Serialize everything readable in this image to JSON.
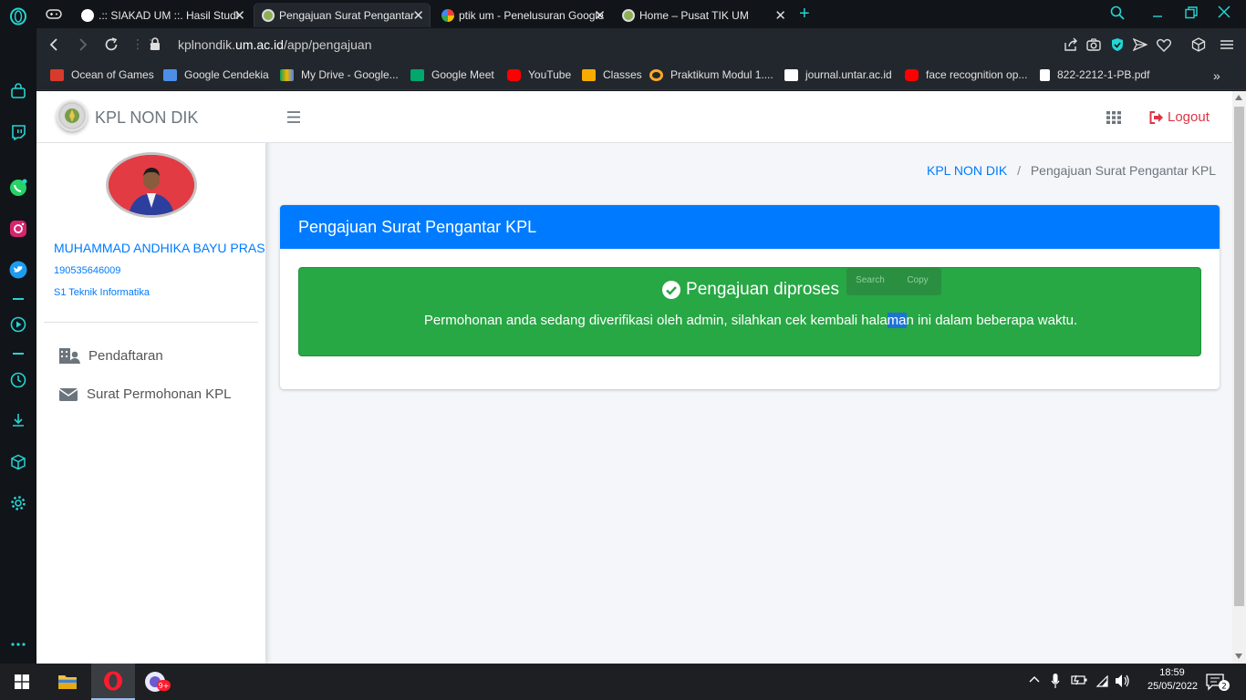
{
  "browser": {
    "tabs": [
      {
        "title": ".:: SIAKAD UM ::. Hasil Studi",
        "active": false
      },
      {
        "title": "Pengajuan Surat Pengantar",
        "active": true
      },
      {
        "title": "ptik um - Penelusuran Google",
        "active": false
      },
      {
        "title": "Home – Pusat TIK UM",
        "active": false
      }
    ],
    "url_prefix": "kplnondik.",
    "url_domain": "um.ac.id",
    "url_path": "/app/pengajuan",
    "bookmarks": [
      {
        "label": "Ocean of Games",
        "icon": "gamepad-icon",
        "color": "#d83a2c"
      },
      {
        "label": "Google Cendekia",
        "icon": "graduation-cap-icon",
        "color": "#4d8fe8"
      },
      {
        "label": "My Drive - Google...",
        "icon": "google-drive-icon",
        "color": "#f4b400"
      },
      {
        "label": "Google Meet",
        "icon": "google-meet-icon",
        "color": "#00a86b"
      },
      {
        "label": "YouTube",
        "icon": "youtube-icon",
        "color": "#ff0000"
      },
      {
        "label": "Classes",
        "icon": "classroom-icon",
        "color": "#f9ab00"
      },
      {
        "label": "Praktikum Modul 1....",
        "icon": "colab-icon",
        "color": "#f9a825"
      },
      {
        "label": "journal.untar.ac.id",
        "icon": "pkp-icon",
        "color": "#ffffff"
      },
      {
        "label": "face recognition op...",
        "icon": "youtube-icon",
        "color": "#ff0000"
      },
      {
        "label": "822-2212-1-PB.pdf",
        "icon": "file-icon",
        "color": "#ffffff"
      }
    ]
  },
  "app": {
    "brand": "KPL NON DIK",
    "user_name": "MUHAMMAD ANDHIKA BAYU PRAS",
    "user_nim": "190535646009",
    "user_prodi": "S1 Teknik Informatika",
    "nav": [
      {
        "label": "Pendaftaran",
        "icon": "users-building-icon"
      },
      {
        "label": "Surat Permohonan KPL",
        "icon": "envelope-icon"
      }
    ],
    "logout_label": "Logout",
    "breadcrumb_home": "KPL NON DIK",
    "breadcrumb_sep": "/",
    "breadcrumb_current": "Pengajuan Surat Pengantar KPL",
    "card_title": "Pengajuan Surat Pengantar KPL",
    "alert_title": "Pengajuan diproses",
    "alert_msg_before": "Permohonan anda sedang diverifikasi oleh admin, silahkan cek kembali hala",
    "alert_msg_selected": "ma",
    "alert_msg_after": "n ini dalam beberapa waktu.",
    "selection_menu": {
      "search": "Search",
      "copy": "Copy"
    }
  },
  "taskbar": {
    "time": "18:59",
    "date": "25/05/2022",
    "notification_count": "2",
    "opera_badge": "9+"
  },
  "colors": {
    "primary": "#007bff",
    "success": "#28a745",
    "logout": "#dc3545",
    "browser_accent": "#23d5d5"
  }
}
